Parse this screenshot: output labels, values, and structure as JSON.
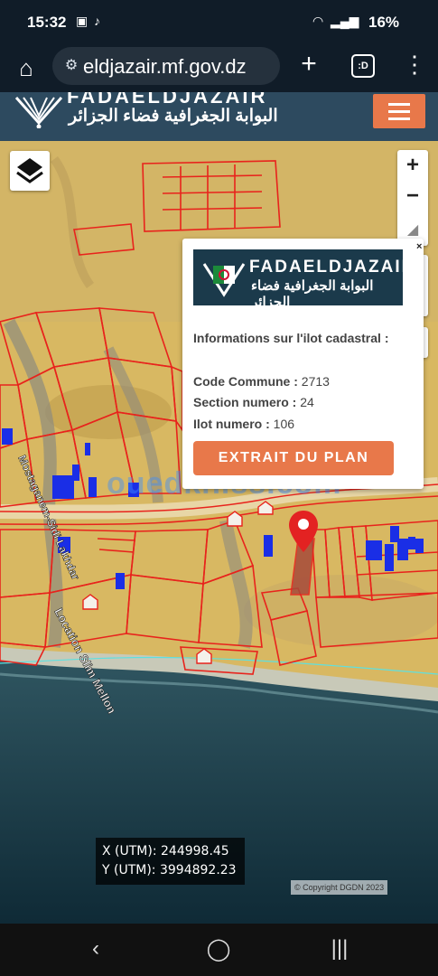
{
  "status_bar": {
    "time": "15:32",
    "battery": "16%"
  },
  "browser": {
    "url": "eldjazair.mf.gov.dz",
    "tabs_label": ":D"
  },
  "site": {
    "logo_title": "FADAELDJAZAIR",
    "logo_subtitle": "البوابة الجغرافية فضاء الجزائر"
  },
  "popup": {
    "logo_title": "FADAELDJAZAIR",
    "logo_subtitle": "البوابة الجغرافية فضاء الجزائر",
    "heading": "Informations sur l'ilot cadastral :",
    "commune_label": "Code Commune :",
    "commune_value": "2713",
    "section_label": "Section numero :",
    "section_value": "24",
    "ilot_label": "Ilot numero :",
    "ilot_value": "106",
    "button_label": "EXTRAIT DU PLAN"
  },
  "coords": {
    "x_text": "X (UTM): 244998.45",
    "y_text": "Y (UTM): 3994892.23"
  },
  "map_labels": {
    "road1": "Mostaganem-Sidi Lakhdar",
    "road2": "Location Slim Mellon"
  },
  "copyright": "© Copyright DGDN 2023",
  "watermark": "ouedkniss.com",
  "colors": {
    "header": "#2d4a5f",
    "accent": "#e8784a",
    "parcel_lines": "#e8231c",
    "buildings": "#1a2ee6",
    "sea": "#1f3f4f"
  },
  "icons": [
    "layers-icon",
    "zoom-in-icon",
    "zoom-out-icon",
    "compass-icon",
    "draw-polygon-icon",
    "trash-icon",
    "locate-icon",
    "map-marker-icon"
  ]
}
